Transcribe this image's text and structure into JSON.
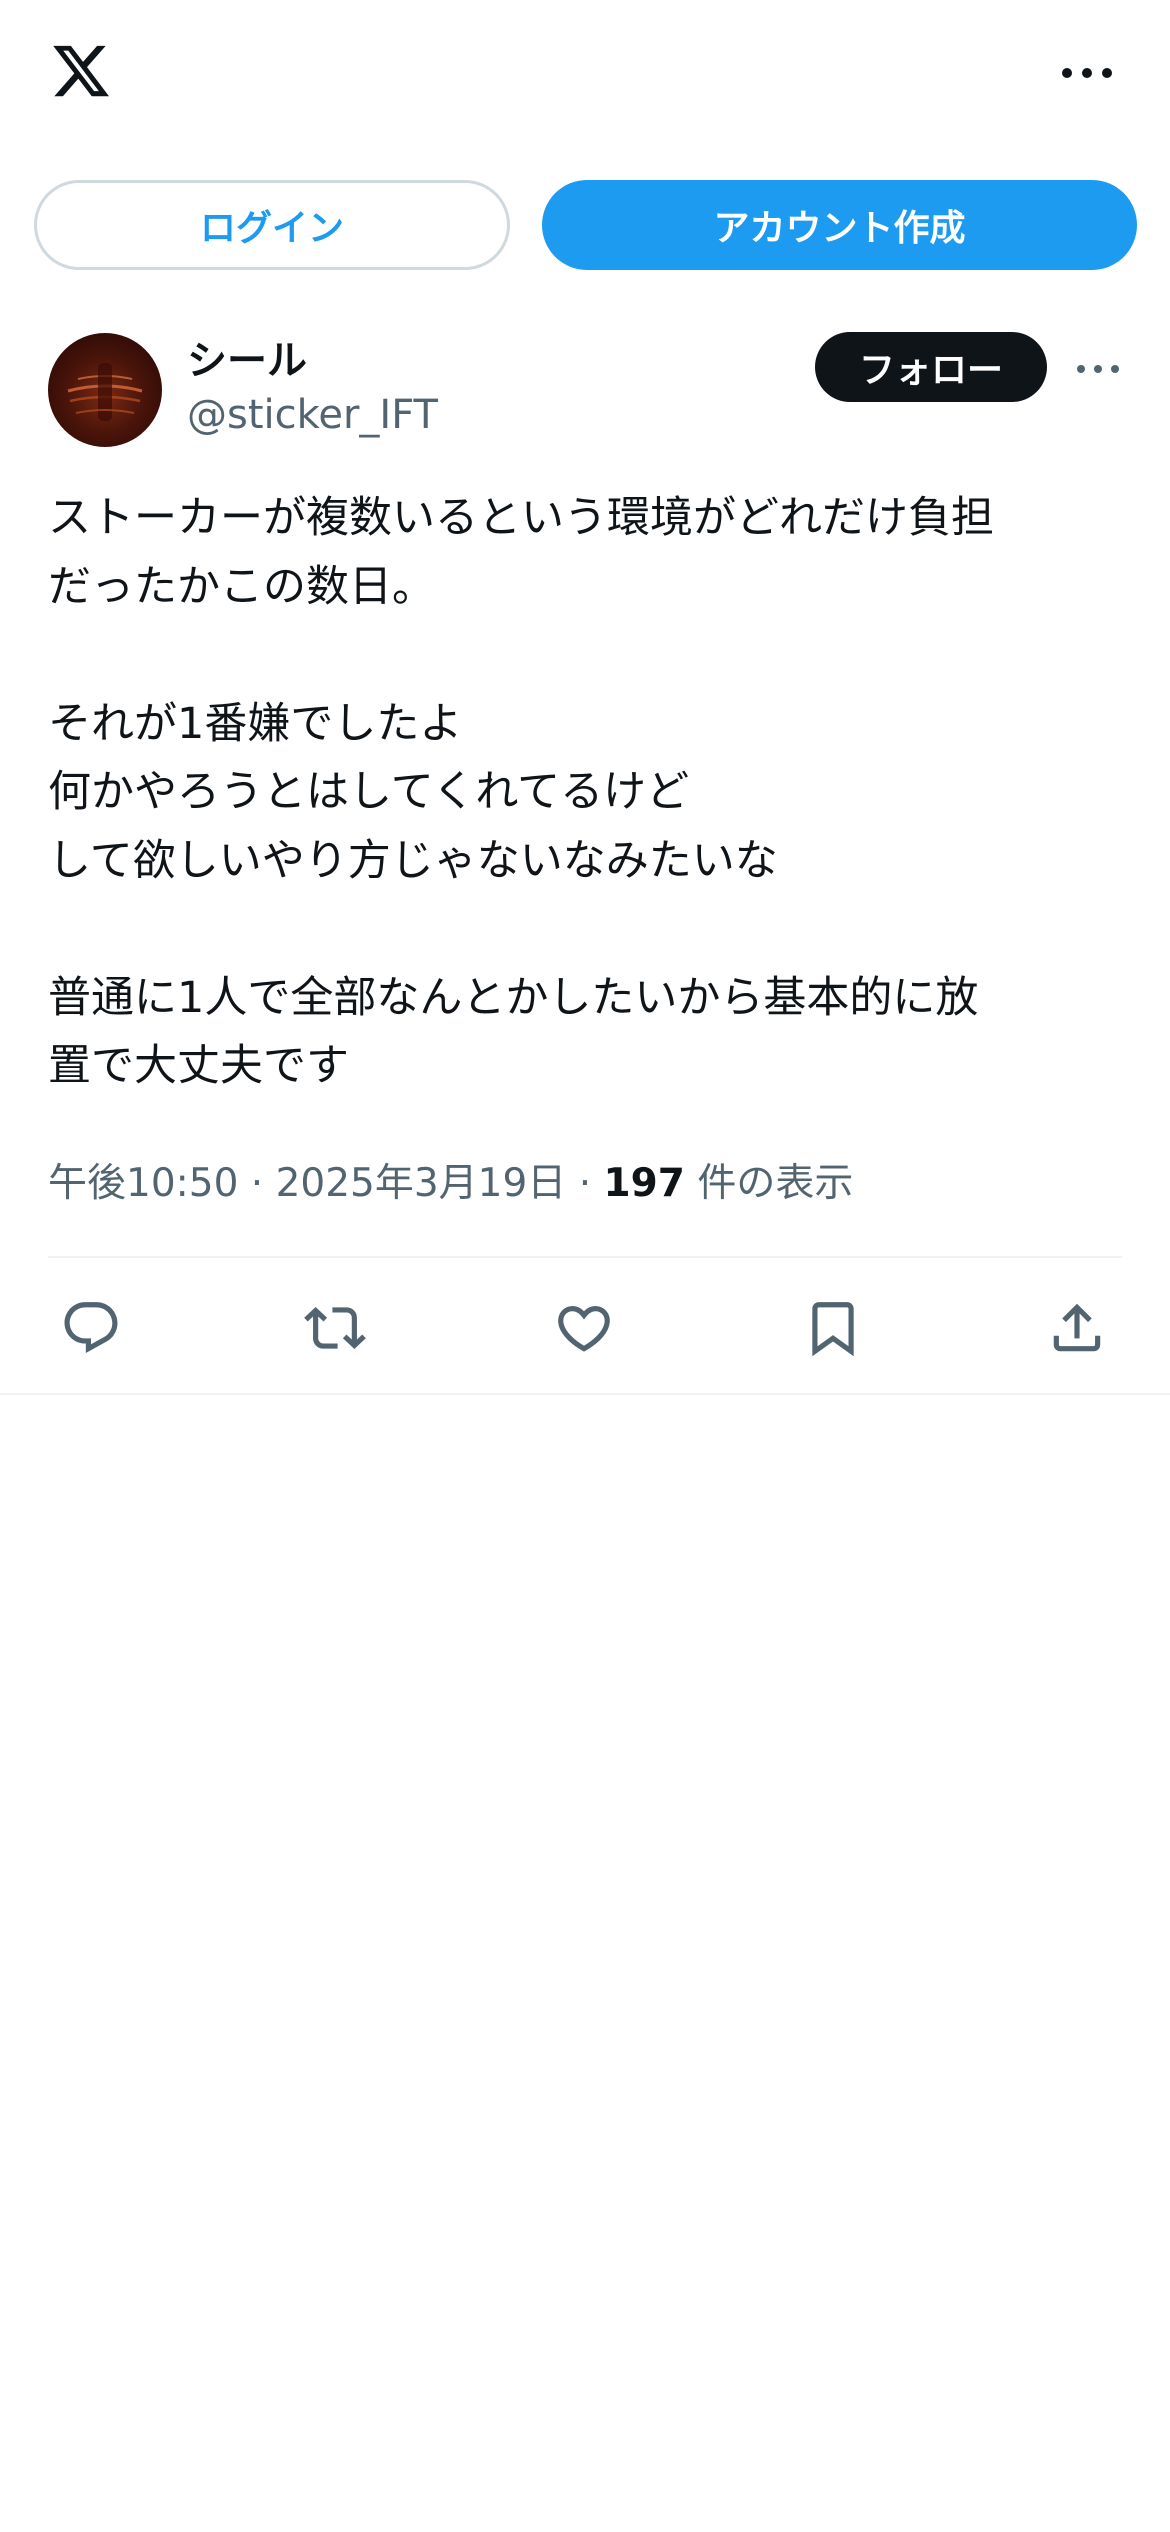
{
  "app": {
    "logo_icon": "x-logo-icon",
    "more_icon": "more-horizontal-icon"
  },
  "auth": {
    "login_label": "ログイン",
    "signup_label": "アカウント作成"
  },
  "tweet": {
    "author": {
      "display_name": "シール",
      "handle": "@sticker_IFT"
    },
    "follow_label": "フォロー",
    "text_lines": [
      "ストーカーが複数いるという環境がどれだけ負担",
      "だったかこの数日。",
      "",
      "それが1番嫌でしたよ",
      "何かやろうとはしてくれてるけど",
      "して欲しいやり方じゃないなみたいな",
      "",
      "普通に1人で全部なんとかしたいから基本的に放",
      "置で大丈夫です"
    ],
    "meta": {
      "time": "午後10:50",
      "separator": " · ",
      "date": "2025年3月19日",
      "views_count": "197",
      "views_label": " 件の表示"
    },
    "actions": [
      "reply-icon",
      "retweet-icon",
      "like-icon",
      "bookmark-icon",
      "share-icon"
    ]
  },
  "colors": {
    "accent": "#1d9bf0",
    "text": "#0f1419",
    "secondary": "#536471",
    "border": "#cfd9de"
  }
}
